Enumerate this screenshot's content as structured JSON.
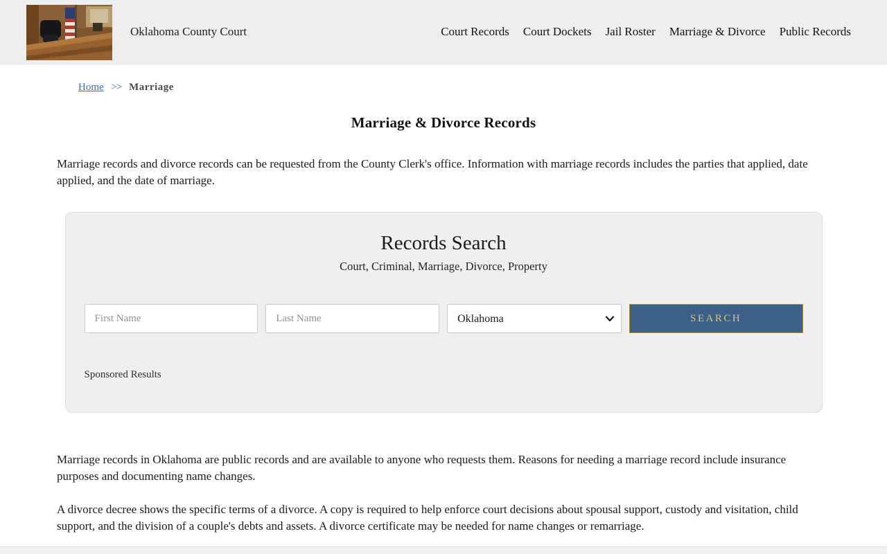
{
  "header": {
    "site_title": "Oklahoma County Court",
    "logo_alt": "courtroom-photo",
    "nav": [
      {
        "label": "Court Records"
      },
      {
        "label": "Court Dockets"
      },
      {
        "label": "Jail Roster"
      },
      {
        "label": "Marriage & Divorce"
      },
      {
        "label": "Public Records"
      }
    ]
  },
  "breadcrumb": {
    "home_label": "Home",
    "separator": ">>",
    "current_label": "Marriage"
  },
  "page": {
    "title": "Marriage & Divorce Records",
    "intro_paragraph": "Marriage records and divorce records can be requested from the County Clerk's office. Information with marriage records includes the parties that applied, date applied, and the date of marriage.",
    "paragraph_public_records": "Marriage records in Oklahoma are public records and are available to anyone who requests them. Reasons for needing a marriage record include insurance purposes and documenting name changes.",
    "paragraph_divorce_decree": "A divorce decree shows the specific terms of a divorce. A copy is required to help enforce court decisions about spousal support, custody and visitation, child support, and the division of a couple's debts and assets. A divorce certificate may be needed for name changes or remarriage."
  },
  "search": {
    "title": "Records Search",
    "subtitle": "Court, Criminal, Marriage, Divorce, Property",
    "first_name_placeholder": "First Name",
    "last_name_placeholder": "Last Name",
    "state_selected": "Oklahoma",
    "search_button_label": "SEARCH",
    "sponsored_label": "Sponsored Results"
  },
  "colors": {
    "header_bg": "#eeeeee",
    "panel_bg": "#efefef",
    "button_blue": "#3b5f88",
    "button_border_gold": "#a89035",
    "button_text_gold": "#d9c57f",
    "link_blue": "#2e6bc7"
  }
}
